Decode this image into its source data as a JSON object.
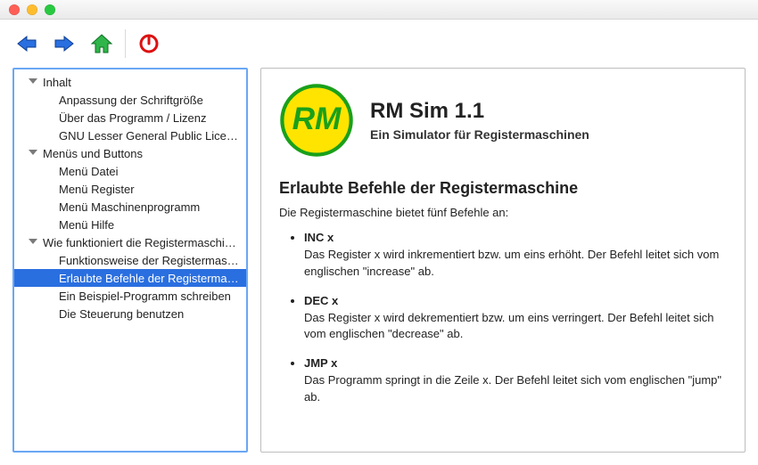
{
  "toolbar": {
    "back": "Back",
    "forward": "Forward",
    "home": "Home",
    "power": "Power"
  },
  "nav": {
    "sections": [
      {
        "label": "Inhalt",
        "items": [
          {
            "label": "Anpassung der Schriftgröße",
            "selected": false
          },
          {
            "label": "Über das Programm / Lizenz",
            "selected": false
          },
          {
            "label": "GNU Lesser General Public Lice…",
            "selected": false
          }
        ]
      },
      {
        "label": "Menüs und Buttons",
        "items": [
          {
            "label": "Menü Datei",
            "selected": false
          },
          {
            "label": "Menü Register",
            "selected": false
          },
          {
            "label": "Menü Maschinenprogramm",
            "selected": false
          },
          {
            "label": "Menü Hilfe",
            "selected": false
          }
        ]
      },
      {
        "label": "Wie funktioniert die Registermaschi…",
        "items": [
          {
            "label": "Funktionsweise der Registermas…",
            "selected": false
          },
          {
            "label": "Erlaubte Befehle der Registerma…",
            "selected": true
          },
          {
            "label": "Ein Beispiel-Programm schreiben",
            "selected": false
          },
          {
            "label": "Die Steuerung benutzen",
            "selected": false
          }
        ]
      }
    ]
  },
  "detail": {
    "logo_text": "RM",
    "title": "RM Sim 1.1",
    "subtitle": "Ein Simulator für Registermaschinen",
    "heading": "Erlaubte Befehle der Registermaschine",
    "intro": "Die Registermaschine bietet fünf Befehle an:",
    "commands": [
      {
        "name": "INC x",
        "desc": "Das Register x wird inkrementiert bzw. um eins erhöht. Der Befehl leitet sich vom englischen \"increase\" ab."
      },
      {
        "name": "DEC x",
        "desc": "Das Register x wird dekrementiert bzw. um eins verringert. Der Befehl leitet sich vom englischen \"decrease\" ab."
      },
      {
        "name": "JMP x",
        "desc": "Das Programm springt in die Zeile x. Der Befehl leitet sich vom englischen \"jump\" ab."
      }
    ]
  }
}
